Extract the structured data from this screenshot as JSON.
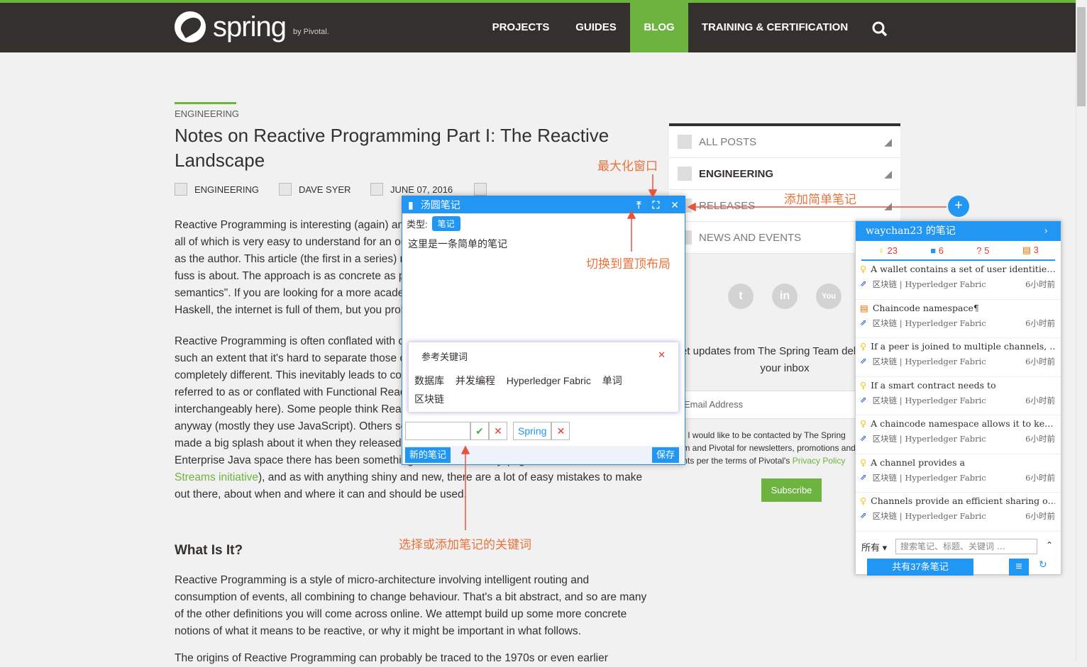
{
  "nav": {
    "logo_text": "spring",
    "logo_by": "by Pivotal.",
    "items": [
      "PROJECTS",
      "GUIDES",
      "BLOG",
      "TRAINING & CERTIFICATION"
    ],
    "active": "BLOG"
  },
  "article": {
    "category": "ENGINEERING",
    "title": "Notes on Reactive Programming Part I: The Reactive Landscape",
    "meta_category": "ENGINEERING",
    "author": "DAVE SYER",
    "date": "JUNE 07, 2016",
    "p1": "Reactive Programming is interesting (again) and there is a lot of noise about it at the moment, not all of which is very easy to understand for an outsider and simple enterprise Java developer, such as the author. This article (the first in a series) might help to clarify your understanding of what the fuss is about. The approach is as concrete as possible, and there is no mention of \"denotational semantics\". If you are looking for a more academic approach and loads of code samples in Haskell, the internet is full of them, but you probably don't want to be here.",
    "p2a": "Reactive Programming is often conflated with concurrent programming and high performance to such an extent that it's hard to separate those concepts, when actually they are in principle completely different. This inevitably leads to confusion. Reactive Programming is also often referred to as or conflated with Functional Reactive Programming, or FRP (and we use the two interchangeably here). Some people think Reactive is nothing new, and it's what they do all day anyway (mostly they use JavaScript). Others seem to think that it's a gift from Microsoft (who made a big splash about it when they released some C# extensions a while ago). In the Enterprise Java space there has been something of a buzz recently (e.g. see the ",
    "p2link": "Reactive Streams initiative",
    "p2b": "), and as with anything shiny and new, there are a lot of easy mistakes to make out there, about when and where it can and should be used.",
    "h2": "What Is It?",
    "p3": "Reactive Programming is a style of micro-architecture involving intelligent routing and consumption of events, all combining to change behaviour. That's a bit abstract, and so are many of the other definitions you will come across online. We attempt build up some more concrete notions of what it means to be reactive, or why it might be important in what follows.",
    "p4": "The origins of Reactive Programming can probably be traced to the 1970s or even earlier"
  },
  "sidebar": {
    "items": [
      "ALL POSTS",
      "ENGINEERING",
      "RELEASES",
      "NEWS AND EVENTS"
    ],
    "active": "ENGINEERING",
    "social": [
      "t",
      "in",
      "You"
    ],
    "updates": "Get updates from The Spring Team delivered to your inbox",
    "email_placeholder": "Email Address",
    "consent": "Yes, I would like to be contacted by The Spring Team and Pivotal for newsletters, promotions and events per the terms of Pivotal's",
    "privacy": "Privacy Policy",
    "subscribe": "Subscribe"
  },
  "annotations": {
    "maximize": "最大化窗口",
    "add_simple": "添加简单笔记",
    "top_layout": "切换到置顶布局",
    "keywords": "选择或添加笔记的关键词"
  },
  "note_window": {
    "title": "汤圆笔记",
    "type_label": "类型:",
    "type_value": "笔记",
    "content": "这里是一条简单的笔记",
    "kw_header": "参考关键词",
    "keywords": [
      "数据库",
      "并发编程",
      "Hyperledger Fabric",
      "单词",
      "区块链"
    ],
    "tag": "Spring",
    "new_note": "新的笔记",
    "save": "保存"
  },
  "panel": {
    "title": "waychan23 的笔记",
    "stats": [
      {
        "icon": "bulb",
        "count": "23"
      },
      {
        "icon": "doc",
        "count": "6"
      },
      {
        "icon": "question",
        "count": "5"
      },
      {
        "icon": "clip",
        "count": "3"
      }
    ],
    "items": [
      {
        "icon": "bulb",
        "title": "A wallet contains a set of user identitie…",
        "tags": "区块链 | Hyperledger Fabric",
        "time": "6小时前"
      },
      {
        "icon": "clip",
        "title": "Chaincode namespace¶",
        "tags": "区块链 | Hyperledger Fabric",
        "time": "6小时前"
      },
      {
        "icon": "bulb",
        "title": "If a peer is joined to multiple channels, …",
        "tags": "区块链 | Hyperledger Fabric",
        "time": "6小时前"
      },
      {
        "icon": "bulb",
        "title": "If a smart contract needs to",
        "tags": "区块链 | Hyperledger Fabric",
        "time": "6小时前"
      },
      {
        "icon": "bulb",
        "title": "A chaincode namespace allows it to ke…",
        "tags": "区块链 | Hyperledger Fabric",
        "time": "6小时前"
      },
      {
        "icon": "bulb",
        "title": "A channel provides a",
        "tags": "区块链 | Hyperledger Fabric",
        "time": "6小时前"
      },
      {
        "icon": "bulb",
        "title": "Channels provide an efficient sharing o…",
        "tags": "区块链 | Hyperledger Fabric",
        "time": "6小时前"
      }
    ],
    "filter": "所有",
    "search_placeholder": "搜索笔记、标题、关键词 …",
    "count": "共有37条笔记"
  },
  "colors": {
    "brand": "#6db33f",
    "dark": "#34302d",
    "blue": "#2196f3",
    "annotation": "#e8733c"
  }
}
